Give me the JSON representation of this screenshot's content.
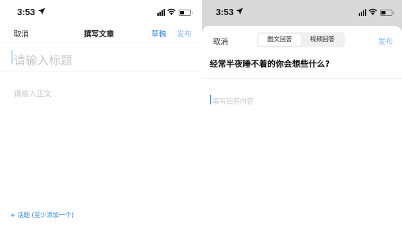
{
  "left": {
    "status": {
      "time": "3:53"
    },
    "nav": {
      "cancel": "取消",
      "title": "撰写文章",
      "draft": "草稿",
      "publish": "发布"
    },
    "title_placeholder": "请输入标题",
    "body_placeholder": "请输入正文",
    "topic_link": "+ 话题 (至少添加一个)"
  },
  "right": {
    "status": {
      "time": "3:53"
    },
    "nav": {
      "cancel": "取消",
      "tabs": [
        {
          "label": "图文回答",
          "active": true
        },
        {
          "label": "视频回答",
          "active": false
        }
      ],
      "publish": "发布"
    },
    "question": "经常半夜睡不着的你会想些什么?",
    "answer_placeholder": "填写回答内容"
  },
  "icons": [
    "location-arrow-icon",
    "signal-icon",
    "wifi-icon",
    "battery-icon"
  ],
  "colors": {
    "accent": "#2f86e8",
    "accent_disabled": "#8cbcf2",
    "placeholder": "#c8c8c8",
    "backdrop": "#d9d9d9"
  }
}
